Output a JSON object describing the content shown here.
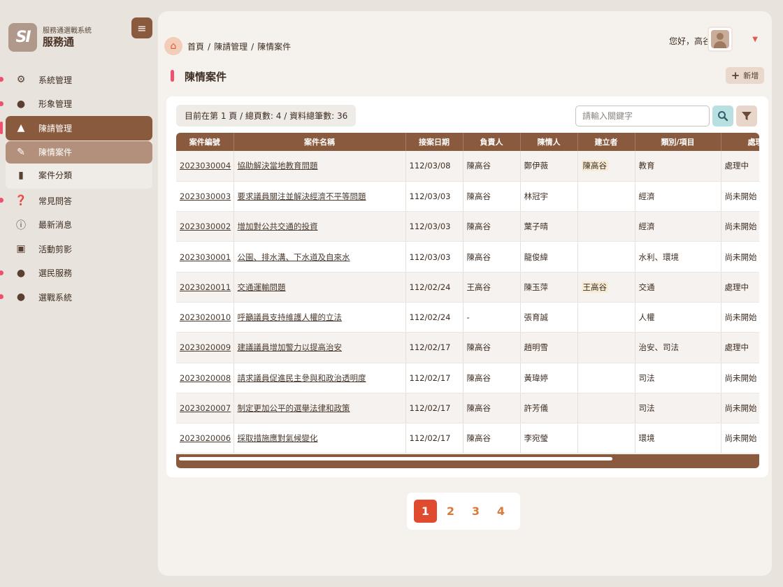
{
  "app": {
    "subtitle": "服務通選戰系統",
    "name": "服務通",
    "logo_text": "SI"
  },
  "sidebar": {
    "items": [
      {
        "label": "系統管理",
        "icon": "gear-icon"
      },
      {
        "label": "形象管理",
        "icon": "user-gear-icon"
      },
      {
        "label": "陳請管理",
        "icon": "handshake-icon"
      },
      {
        "label": "常見問答",
        "icon": "question-icon"
      },
      {
        "label": "最新消息",
        "icon": "info-icon"
      },
      {
        "label": "活動剪影",
        "icon": "images-icon"
      },
      {
        "label": "選民服務",
        "icon": "user-check-icon"
      },
      {
        "label": "選戰系統",
        "icon": "user-icon"
      }
    ],
    "sub_items": [
      {
        "label": "陳情案件",
        "icon": "file-edit-icon"
      },
      {
        "label": "案件分類",
        "icon": "file-icon"
      }
    ]
  },
  "breadcrumb": [
    "首頁",
    "陳請管理",
    "陳情案件"
  ],
  "header": {
    "greeting": "您好，高谷"
  },
  "page": {
    "title": "陳情案件",
    "add_label": "新增"
  },
  "toolbar": {
    "info": "目前在第 1 頁 / 總頁數: 4 / 資料總筆數: 36",
    "search_placeholder": "請輸入關鍵字"
  },
  "table": {
    "columns": [
      "案件編號",
      "案件名稱",
      "接案日期",
      "負責人",
      "陳情人",
      "建立者",
      "類別/項目",
      "處理狀態"
    ],
    "rows": [
      [
        "2023030004",
        "協助解決當地教育問題",
        "112/03/08",
        "陳高谷",
        "鄭伊薇",
        "陳高谷",
        "教育",
        "處理中"
      ],
      [
        "2023030003",
        "要求議員關注並解決經濟不平等問題",
        "112/03/03",
        "陳高谷",
        "林冠宇",
        "",
        "經濟",
        "尚未開始"
      ],
      [
        "2023030002",
        "增加對公共交通的投資",
        "112/03/03",
        "陳高谷",
        "葉子晴",
        "",
        "經濟",
        "尚未開始"
      ],
      [
        "2023030001",
        "公園、排水溝、下水道及自來水",
        "112/03/03",
        "陳高谷",
        "龍俊緯",
        "",
        "水利、環境",
        "尚未開始"
      ],
      [
        "2023020011",
        "交通運輸問題",
        "112/02/24",
        "王高谷",
        "陳玉萍",
        "王高谷",
        "交通",
        "處理中"
      ],
      [
        "2023020010",
        "呼籲議員支持維護人權的立法",
        "112/02/24",
        "-",
        "張育誠",
        "",
        "人權",
        "尚未開始"
      ],
      [
        "2023020009",
        "建議議員增加警力以提高治安",
        "112/02/17",
        "陳高谷",
        "趙明雪",
        "",
        "治安、司法",
        "處理中"
      ],
      [
        "2023020008",
        "請求議員促進民主參與和政治透明度",
        "112/02/17",
        "陳高谷",
        "黃瑋婷",
        "",
        "司法",
        "尚未開始"
      ],
      [
        "2023020007",
        "制定更加公平的選舉法律和政策",
        "112/02/17",
        "陳高谷",
        "許芳儀",
        "",
        "司法",
        "尚未開始"
      ],
      [
        "2023020006",
        "採取措施應對氣候變化",
        "112/02/17",
        "陳高谷",
        "李宛瑩",
        "",
        "環境",
        "尚未開始"
      ]
    ]
  },
  "pagination": {
    "pages": [
      "1",
      "2",
      "3",
      "4"
    ],
    "current": "1"
  },
  "colors": {
    "primary": "#8a5a3e",
    "accent": "#f0506e",
    "page_active": "#e04a2e"
  }
}
